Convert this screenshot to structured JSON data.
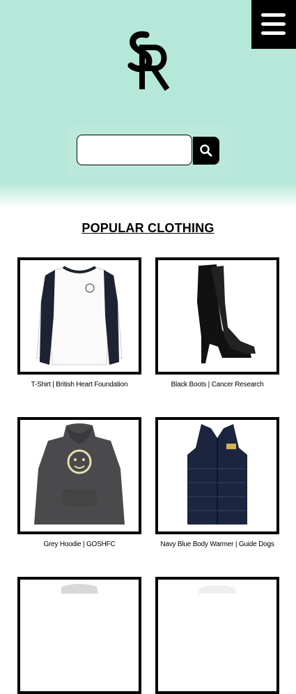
{
  "header": {
    "logo_text": "SR",
    "menu_icon": "hamburger-icon"
  },
  "search": {
    "placeholder": "",
    "value": "",
    "icon": "search-icon"
  },
  "main": {
    "section_title": "POPULAR CLOTHING",
    "products": [
      {
        "caption": "T-Shirt | British Heart Foundation",
        "image": "white-long-sleeve-tshirt"
      },
      {
        "caption": "Black Boots | Cancer Research",
        "image": "black-knee-high-boot"
      },
      {
        "caption": "Grey Hoodie | GOSHFC",
        "image": "grey-hoodie"
      },
      {
        "caption": "Navy Blue Body Warmer | Guide Dogs",
        "image": "navy-body-warmer"
      },
      {
        "caption": "",
        "image": "grey-garment-partial"
      },
      {
        "caption": "",
        "image": "white-garment-partial"
      }
    ]
  },
  "colors": {
    "hero_bg": "#b5e8d8",
    "accent": "#000000"
  }
}
